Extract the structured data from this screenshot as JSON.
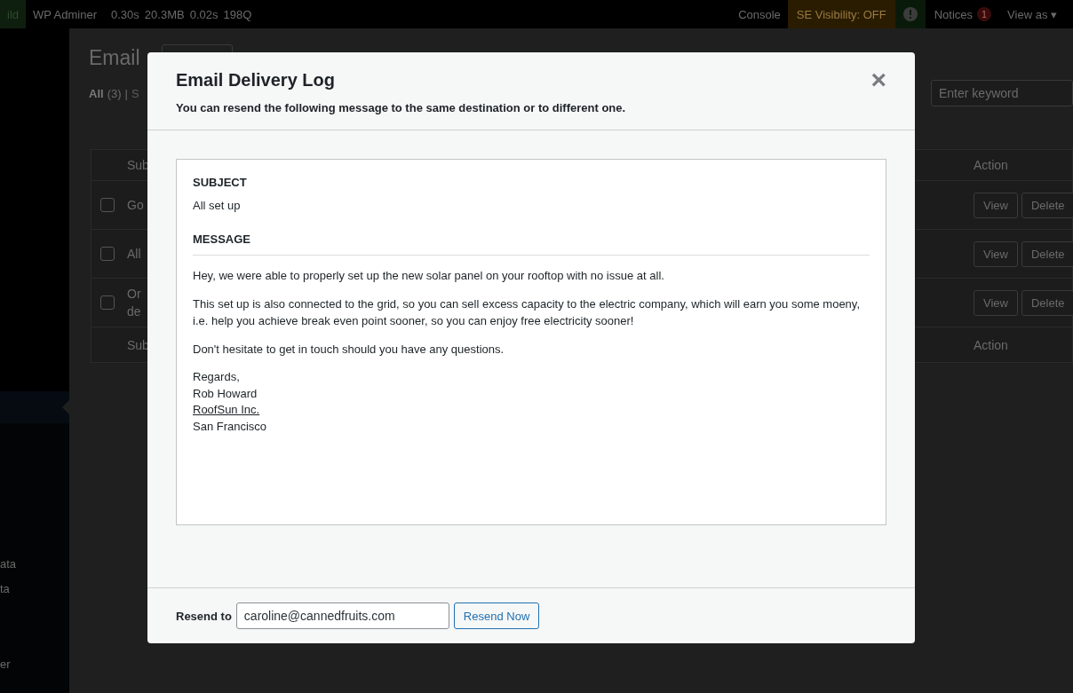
{
  "admin_bar": {
    "site": "ild",
    "items": [
      "WP Adminer"
    ],
    "stats": [
      "0.30s",
      "20.3MB",
      "0.02s",
      "198Q"
    ],
    "console": "Console",
    "se_visibility": "SE Visibility: OFF",
    "notices": {
      "label": "Notices",
      "count": "1"
    },
    "view_as": "View as ▾"
  },
  "sidebar": {
    "items": [
      {
        "label": "ata"
      },
      {
        "label": "ta"
      },
      {
        "label": "er"
      }
    ]
  },
  "page": {
    "title": "Email",
    "filters": [
      {
        "label": "All",
        "count": "(3)",
        "selected": true
      },
      {
        "label": "S",
        "selected": false
      }
    ],
    "separator": "|",
    "search": {
      "placeholder": "Enter keyword"
    }
  },
  "table": {
    "columns": [
      "Sub",
      "Action"
    ],
    "rows": [
      {
        "checked": false,
        "subject": [
          "Go"
        ],
        "actions": [
          "View",
          "Delete"
        ]
      },
      {
        "checked": false,
        "subject": [
          "All"
        ],
        "actions": [
          "View",
          "Delete"
        ]
      },
      {
        "checked": false,
        "subject": [
          "Or",
          "de"
        ],
        "actions": [
          "View",
          "Delete"
        ]
      }
    ],
    "footer": [
      "Sub",
      "Action"
    ]
  },
  "modal": {
    "title": "Email Delivery Log",
    "subtitle": "You can resend the following message to the same destination or to different one.",
    "close": "×",
    "message": {
      "subject_label": "SUBJECT",
      "subject": "All set up",
      "message_label": "MESSAGE",
      "paragraphs": [
        "Hey, we were able to properly set up the new solar panel on your rooftop with no issue at all.",
        "This set up is also connected to the grid, so you can sell excess capacity to the electric company, which will earn you some moeny, i.e. help you achieve break even point sooner, so you can enjoy free electricity sooner!",
        "Don't hesitate to get in touch should you have any questions."
      ],
      "signature": [
        {
          "kind": "text",
          "text": "Regards,"
        },
        {
          "kind": "text",
          "text": "Rob Howard"
        },
        {
          "kind": "link",
          "text": "RoofSun Inc."
        },
        {
          "kind": "text",
          "text": "San Francisco"
        }
      ]
    },
    "resend": {
      "label": "Resend to",
      "value": "caroline@cannedfruits.com",
      "button": "Resend Now"
    }
  }
}
